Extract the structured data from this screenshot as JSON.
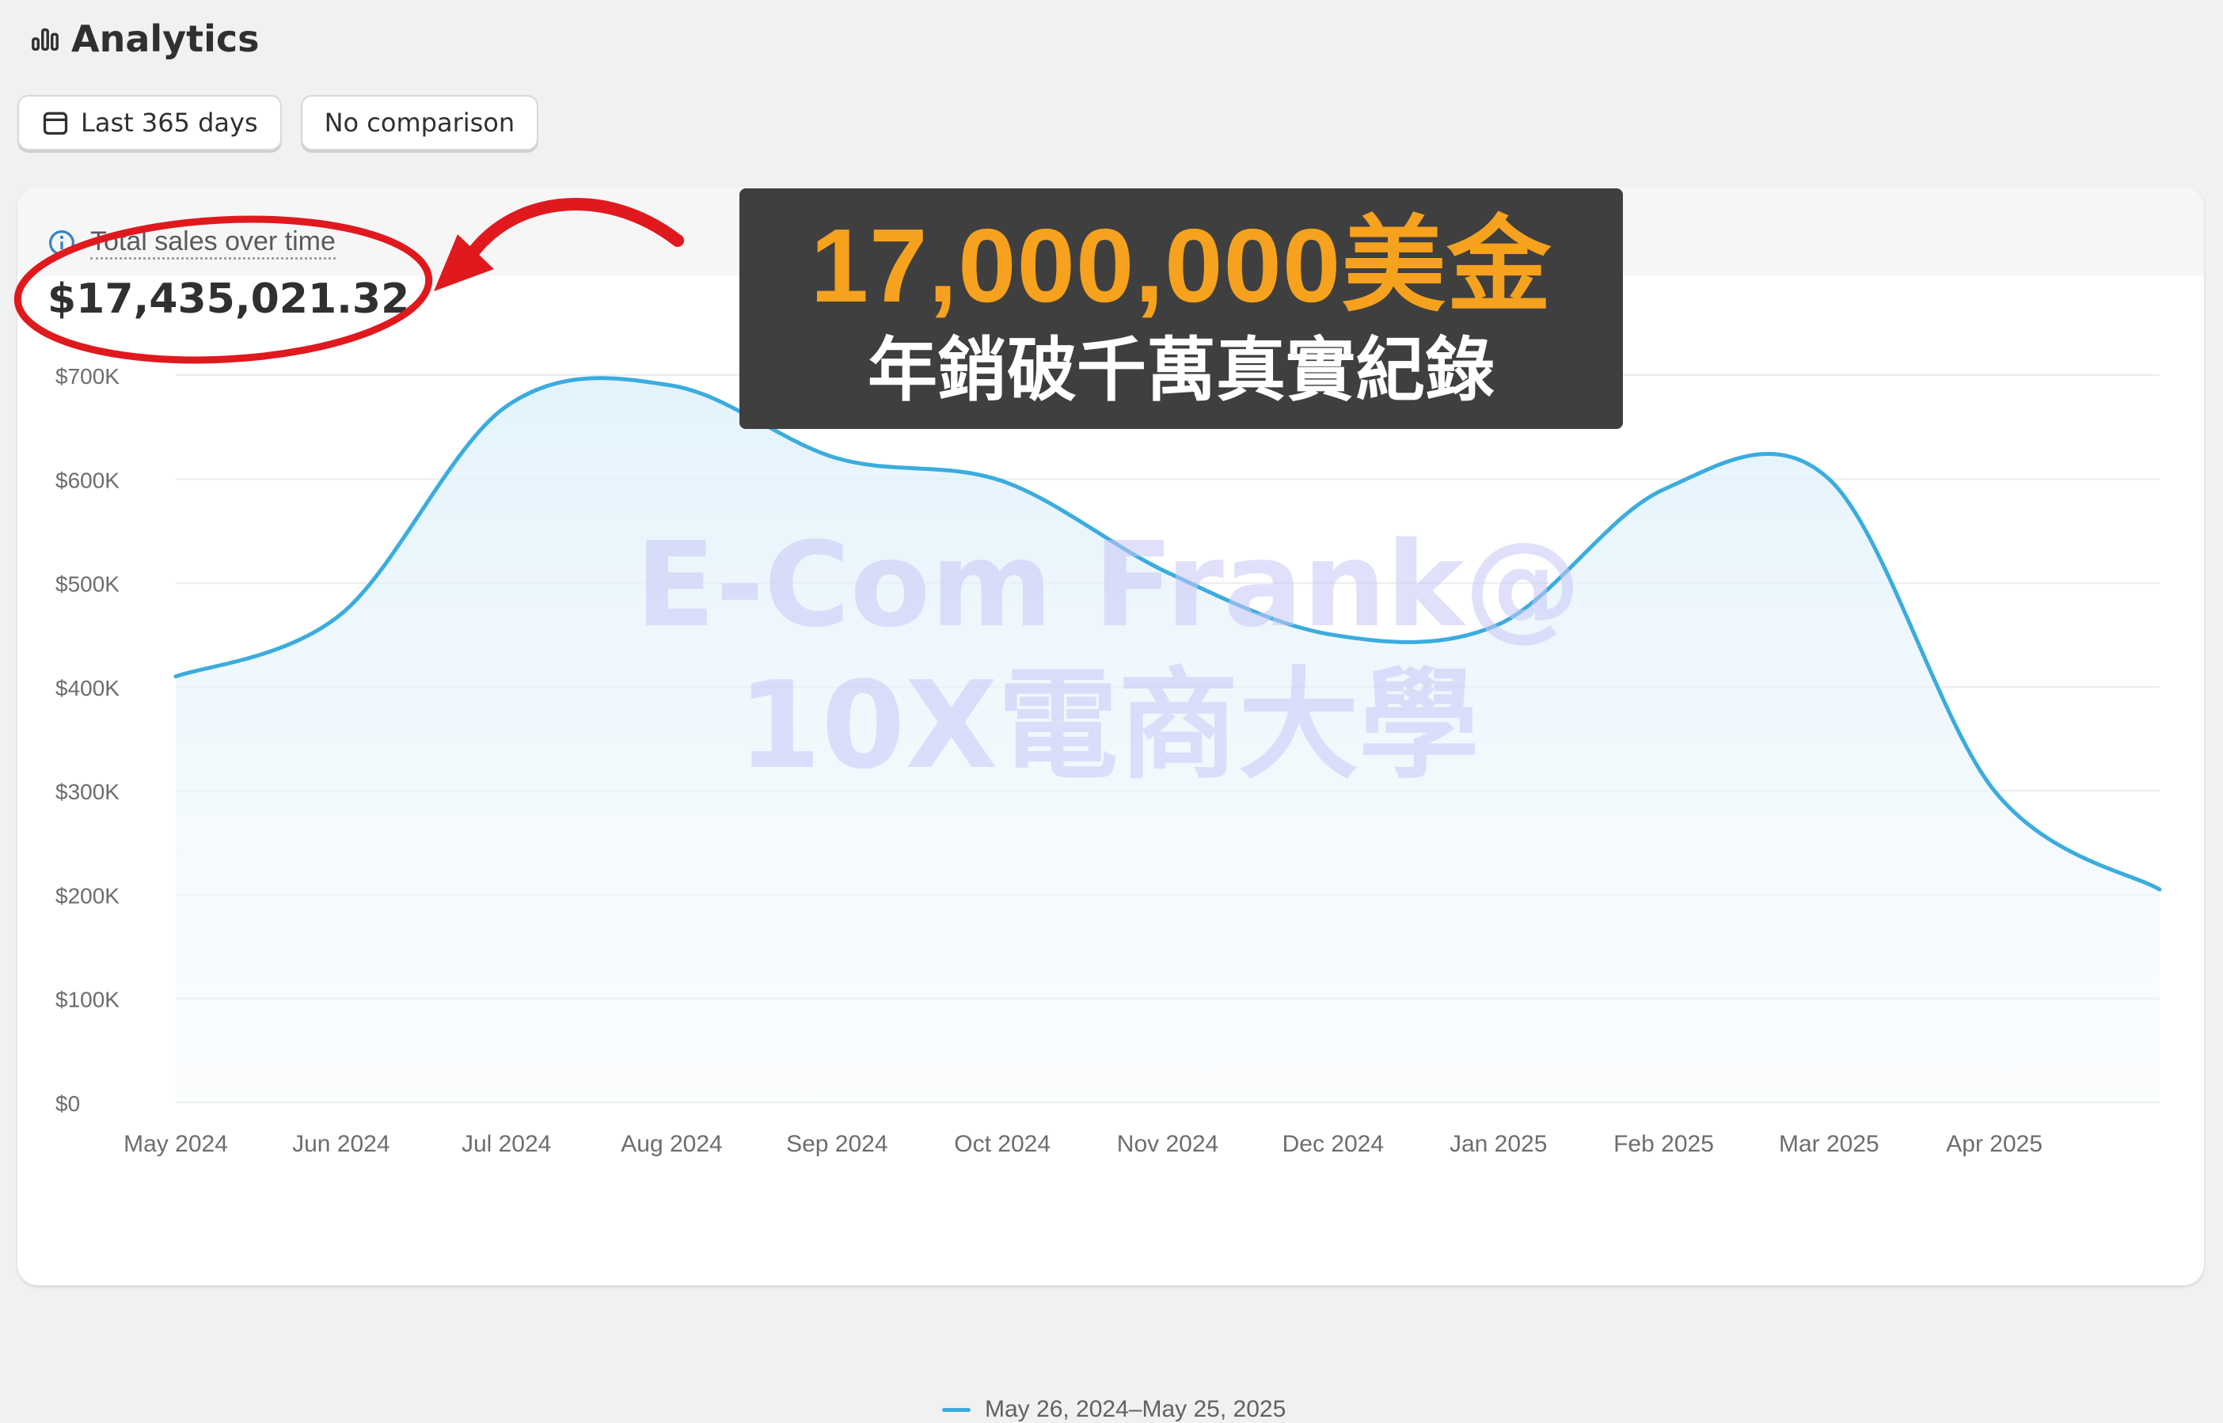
{
  "header": {
    "title": "Analytics"
  },
  "filters": {
    "date_range": "Last 365 days",
    "comparison": "No comparison"
  },
  "card": {
    "metric_title": "Total sales over time",
    "metric_value": "$17,435,021.32"
  },
  "banner": {
    "headline": "17,000,000美金",
    "subline": "年銷破千萬真實紀錄"
  },
  "watermark": {
    "line1": "E-Com Frank@",
    "line2": "10X電商大學"
  },
  "colors": {
    "line": "#3bacde",
    "banner_bg": "#3f3f3f",
    "banner_headline": "#f6a21e",
    "annotation": "#e0191f"
  },
  "chart_data": {
    "type": "area",
    "x_labels": [
      "May 2024",
      "Jun 2024",
      "Jul 2024",
      "Aug 2024",
      "Sep 2024",
      "Oct 2024",
      "Nov 2024",
      "Dec 2024",
      "Jan 2025",
      "Feb 2025",
      "Mar 2025",
      "Apr 2025"
    ],
    "y_ticks": [
      "$0",
      "$100K",
      "$200K",
      "$300K",
      "$400K",
      "$500K",
      "$600K",
      "$700K"
    ],
    "ylim": [
      0,
      700000
    ],
    "grid": true,
    "legend_position": "bottom-center",
    "series": [
      {
        "name": "May 26, 2024–May 25, 2025",
        "x": [
          "May 2024",
          "Jun 2024",
          "Jul 2024",
          "Aug 2024",
          "Sep 2024",
          "Oct 2024",
          "Nov 2024",
          "Dec 2024",
          "Jan 2025",
          "Feb 2025",
          "Mar 2025",
          "Apr 2025",
          "May 2025"
        ],
        "values": [
          410000,
          470000,
          670000,
          690000,
          620000,
          598000,
          510000,
          450000,
          460000,
          590000,
          600000,
          300000,
          205000
        ]
      }
    ]
  }
}
